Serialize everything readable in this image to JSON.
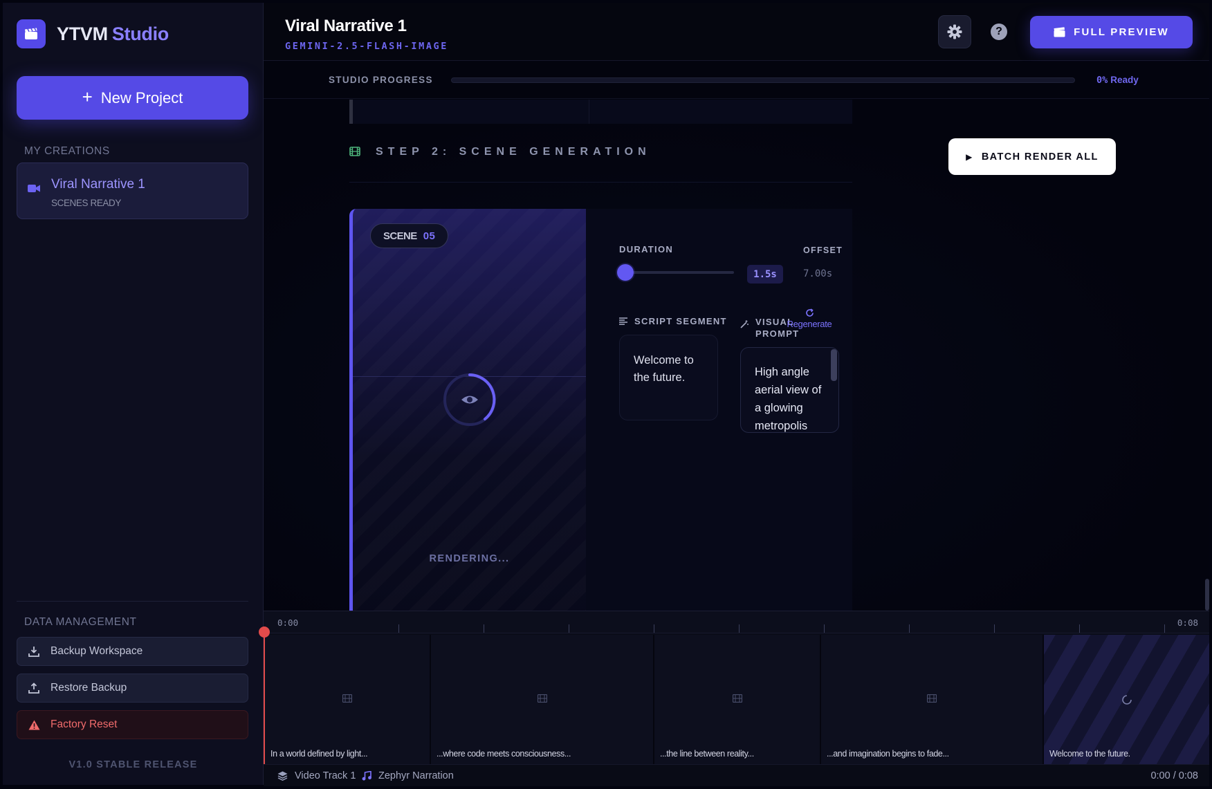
{
  "app": {
    "name": "YTVM",
    "name_accent": "Studio",
    "new_project_label": "New Project"
  },
  "sidebar": {
    "section_creations": "MY CREATIONS",
    "projects": [
      {
        "name": "Viral Narrative 1",
        "status": "SCENES READY"
      }
    ],
    "section_data": "DATA MANAGEMENT",
    "actions": {
      "backup": "Backup Workspace",
      "restore": "Restore Backup",
      "reset": "Factory Reset"
    },
    "release": "V1.0 STABLE RELEASE"
  },
  "header": {
    "title": "Viral Narrative 1",
    "model": "GEMINI-2.5-FLASH-IMAGE",
    "full_preview_label": "FULL PREVIEW",
    "help_glyph": "?"
  },
  "progress": {
    "label": "STUDIO PROGRESS",
    "value": 0,
    "percent_text": "0%",
    "status_text": "Ready"
  },
  "step": {
    "title": "STEP 2: SCENE GENERATION",
    "batch_label": "BATCH RENDER ALL"
  },
  "scene": {
    "badge_label": "SCENE",
    "number": "05",
    "rendering_text": "RENDERING...",
    "duration_label": "DURATION",
    "duration_value": "1.5s",
    "offset_label": "OFFSET",
    "offset_value": "7.00s",
    "script_label": "SCRIPT SEGMENT",
    "script_text": "Welcome to the future.",
    "visual_label_1": "VISUAL",
    "visual_label_2": "PROMPT",
    "regenerate_label": "Regenerate",
    "visual_text": "High angle aerial view of a glowing metropolis"
  },
  "timeline": {
    "start_time": "0:00",
    "end_time": "0:08",
    "clips": [
      {
        "caption": "In a world defined by light..."
      },
      {
        "caption": "...where code meets consciousness..."
      },
      {
        "caption": "...the line between reality..."
      },
      {
        "caption": "...and imagination begins to fade..."
      },
      {
        "caption": "Welcome to the future."
      }
    ],
    "video_track_label": "Video Track 1",
    "audio_track_label": "Zephyr Narration",
    "time_readout": "0:00 / 0:08"
  },
  "colors": {
    "accent": "#554ae6",
    "accent_light": "#8a80ff",
    "danger": "#f06b6b",
    "playhead": "#e24b4b",
    "background": "#03040f"
  },
  "icons": {
    "logo": "clapperboard-icon",
    "project": "video-camera-icon",
    "backup": "download-icon",
    "restore": "upload-icon",
    "reset": "warning-icon",
    "settings": "gear-icon",
    "help": "help-icon",
    "step": "film-icon",
    "preview": "eye-icon",
    "regenerate": "refresh-icon",
    "track": "layers-icon",
    "audio": "music-note-icon"
  }
}
